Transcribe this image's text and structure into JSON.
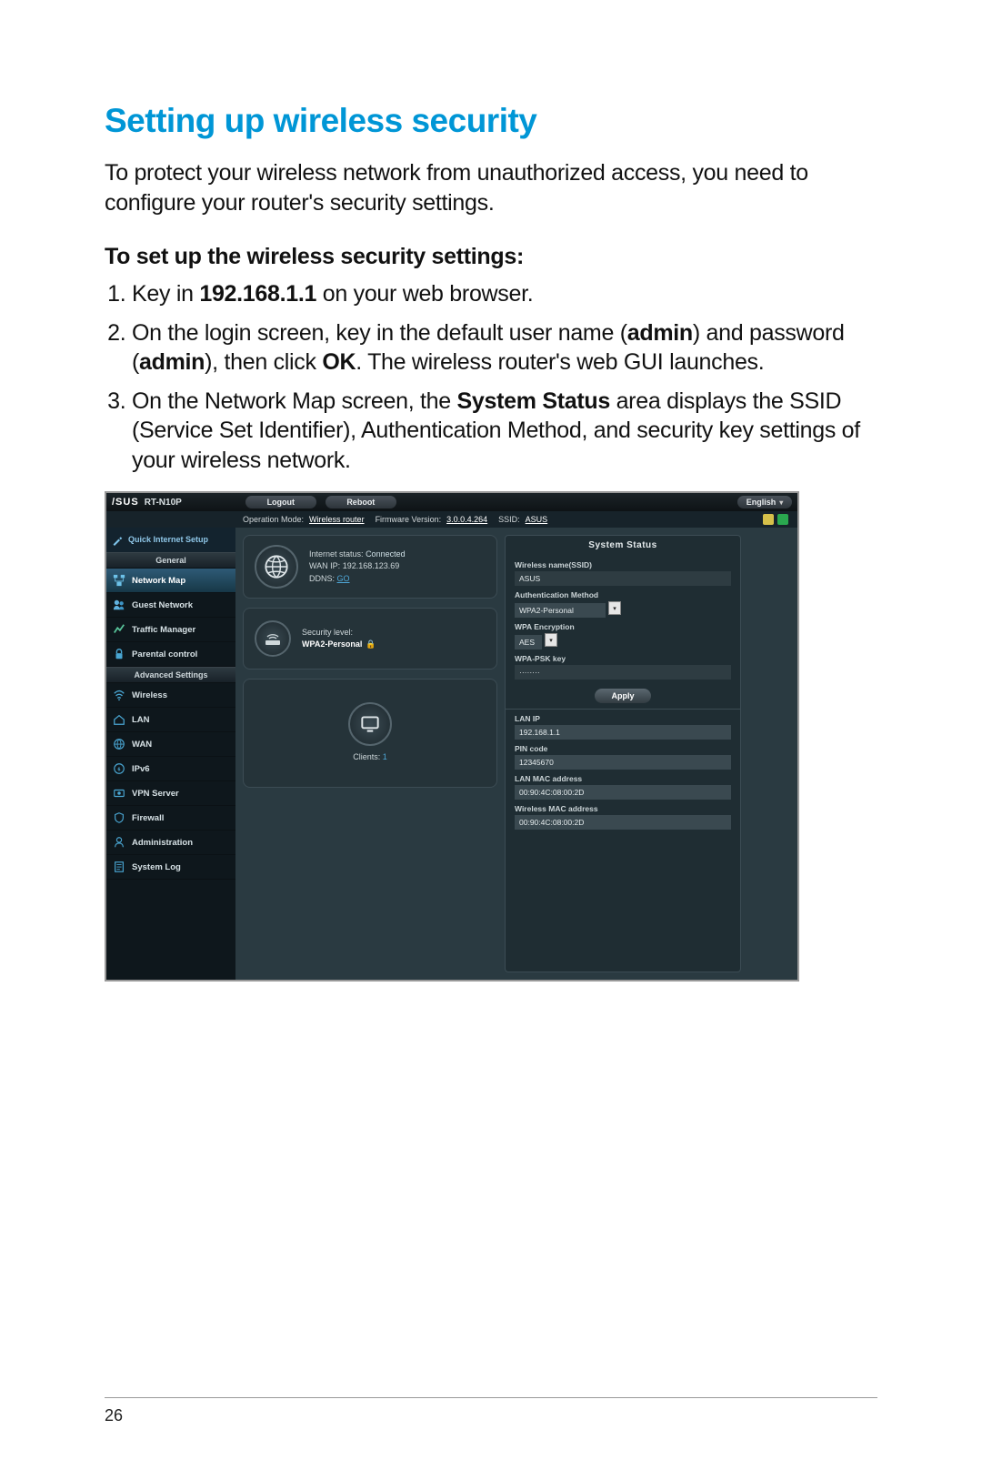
{
  "doc": {
    "title": "Setting up wireless security",
    "intro": "To protect your wireless network from unauthorized access, you need to configure your router's security settings.",
    "subhead": "To set up the wireless security settings:",
    "step1_a": "Key in ",
    "step1_b_bold": "192.168.1.1",
    "step1_c": " on your web browser.",
    "step2_a": "On the login screen, key in the default user name (",
    "step2_b_bold": "admin",
    "step2_c": ") and password (",
    "step2_d_bold": "admin",
    "step2_e": "), then click ",
    "step2_f_bold": "OK",
    "step2_g": ". The wireless router's web GUI launches.",
    "step3_a": "On the Network Map screen, the ",
    "step3_b_bold": "System Status",
    "step3_c": " area displays the SSID (Service Set Identifier), Authentication Method, and security key settings of your wireless network.",
    "page_number": "26"
  },
  "gui": {
    "brand": "/SUS",
    "model": "RT-N10P",
    "top_buttons": {
      "logout": "Logout",
      "reboot": "Reboot"
    },
    "language": "English",
    "infobar": {
      "opmode_label": "Operation Mode:",
      "opmode_value": "Wireless router",
      "fw_label": "Firmware Version:",
      "fw_value": "3.0.0.4.264",
      "ssid_label": "SSID:",
      "ssid_value": "ASUS"
    },
    "sidebar": {
      "qis": "Quick Internet Setup",
      "section_general": "General",
      "items_general": [
        {
          "label": "Network Map"
        },
        {
          "label": "Guest Network"
        },
        {
          "label": "Traffic Manager"
        },
        {
          "label": "Parental control"
        }
      ],
      "section_adv": "Advanced Settings",
      "items_adv": [
        {
          "label": "Wireless"
        },
        {
          "label": "LAN"
        },
        {
          "label": "WAN"
        },
        {
          "label": "IPv6"
        },
        {
          "label": "VPN Server"
        },
        {
          "label": "Firewall"
        },
        {
          "label": "Administration"
        },
        {
          "label": "System Log"
        }
      ]
    },
    "cards": {
      "internet": {
        "status_label": "Internet status:",
        "status_value": "Connected",
        "wan_label": "WAN IP:",
        "wan_value": "192.168.123.69",
        "ddns_label": "DDNS:",
        "ddns_value": "GO"
      },
      "security": {
        "label": "Security level:",
        "value": "WPA2-Personal"
      },
      "clients": {
        "label": "Clients:",
        "value": "1"
      }
    },
    "status": {
      "title": "System Status",
      "ssid_label": "Wireless name(SSID)",
      "ssid_value": "ASUS",
      "auth_label": "Authentication Method",
      "auth_value": "WPA2-Personal",
      "enc_label": "WPA Encryption",
      "enc_value": "AES",
      "psk_label": "WPA-PSK key",
      "psk_value": "········",
      "apply": "Apply",
      "lanip_label": "LAN IP",
      "lanip_value": "192.168.1.1",
      "pin_label": "PIN code",
      "pin_value": "12345670",
      "lanmac_label": "LAN MAC address",
      "lanmac_value": "00:90:4C:08:00:2D",
      "wmac_label": "Wireless MAC address",
      "wmac_value": "00:90:4C:08:00:2D"
    }
  }
}
